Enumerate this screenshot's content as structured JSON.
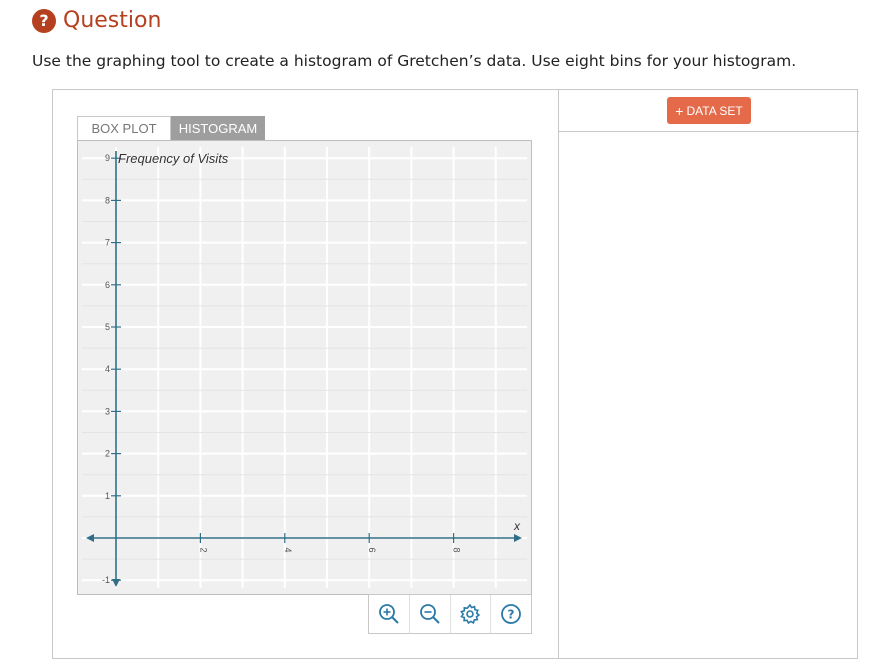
{
  "header": {
    "icon": "question-icon",
    "icon_glyph": "?",
    "title": "Question"
  },
  "question": {
    "text": "Use the graphing tool to create a histogram of Gretchen’s data. Use eight bins for your histogram."
  },
  "tabs": [
    {
      "label": "BOX PLOT"
    },
    {
      "label": "HISTOGRAM",
      "active": true
    }
  ],
  "right_panel": {
    "add_dataset": {
      "plus": "+",
      "label": "DATA SET"
    }
  },
  "graph": {
    "y_axis_label": "Frequency of Visits",
    "x_axis_label": "x",
    "x_ticks": [
      "2",
      "4",
      "6",
      "8"
    ],
    "y_ticks": [
      "9",
      "8",
      "7",
      "6",
      "5",
      "4",
      "3",
      "2",
      "1",
      "-1"
    ]
  },
  "toolbar": {
    "icons": [
      "zoom-in-icon",
      "zoom-out-icon",
      "gear-icon",
      "help-icon"
    ]
  },
  "colors": {
    "accent": "#b5401f",
    "button": "#e46a4a",
    "axis": "#2f6e86",
    "grid": "#ffffff",
    "tool_icon": "#2a7aa8"
  }
}
